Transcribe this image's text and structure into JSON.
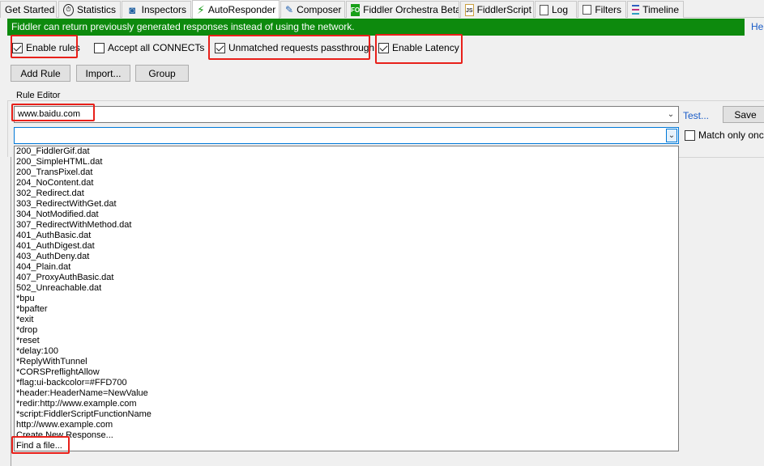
{
  "tabs": [
    {
      "label": "Get Started",
      "icon": "none"
    },
    {
      "label": "Statistics",
      "icon": "stopwatch-icon"
    },
    {
      "label": "Inspectors",
      "icon": "inspectors-icon"
    },
    {
      "label": "AutoResponder",
      "icon": "lightning-icon",
      "active": true
    },
    {
      "label": "Composer",
      "icon": "composer-icon"
    },
    {
      "label": "Fiddler Orchestra Beta",
      "icon": "fo-icon",
      "icon_text": "FO"
    },
    {
      "label": "FiddlerScript",
      "icon": "fiddlerscript-icon",
      "icon_text": "JS"
    },
    {
      "label": "Log",
      "icon": "log-icon"
    },
    {
      "label": "Filters",
      "icon": "filters-icon"
    },
    {
      "label": "Timeline",
      "icon": "timeline-icon"
    }
  ],
  "banner": {
    "text": "Fiddler can return previously generated responses instead of using the network.",
    "help_link": "Hel"
  },
  "options": {
    "enable_rules": {
      "label": "Enable rules",
      "checked": true
    },
    "accept_connects": {
      "label": "Accept all CONNECTs",
      "checked": false
    },
    "unmatched_passthrough": {
      "label": "Unmatched requests passthrough",
      "checked": true
    },
    "enable_latency": {
      "label": "Enable Latency",
      "checked": true
    }
  },
  "toolbar": {
    "add_rule": "Add Rule",
    "import": "Import...",
    "group": "Group"
  },
  "rule_editor": {
    "label": "Rule Editor",
    "match_value": "www.baidu.com",
    "response_value": "",
    "test_link": "Test...",
    "save_label": "Save",
    "match_only_once": {
      "label": "Match only once",
      "checked": false
    }
  },
  "response_options": [
    "200_FiddlerGif.dat",
    "200_SimpleHTML.dat",
    "200_TransPixel.dat",
    "204_NoContent.dat",
    "302_Redirect.dat",
    "303_RedirectWithGet.dat",
    "304_NotModified.dat",
    "307_RedirectWithMethod.dat",
    "401_AuthBasic.dat",
    "401_AuthDigest.dat",
    "403_AuthDeny.dat",
    "404_Plain.dat",
    "407_ProxyAuthBasic.dat",
    "502_Unreachable.dat",
    "*bpu",
    "*bpafter",
    "*exit",
    "*drop",
    "*reset",
    "*delay:100",
    "*ReplyWithTunnel",
    "*CORSPreflightAllow",
    "*flag:ui-backcolor=#FFD700",
    "*header:HeaderName=NewValue",
    "*redir:http://www.example.com",
    "*script:FiddlerScriptFunctionName",
    "http://www.example.com",
    "Create New Response...",
    "Find a file..."
  ],
  "colors": {
    "banner_bg": "#0d8a0d",
    "highlight": "#e8201a",
    "link": "#1a5cc8"
  }
}
